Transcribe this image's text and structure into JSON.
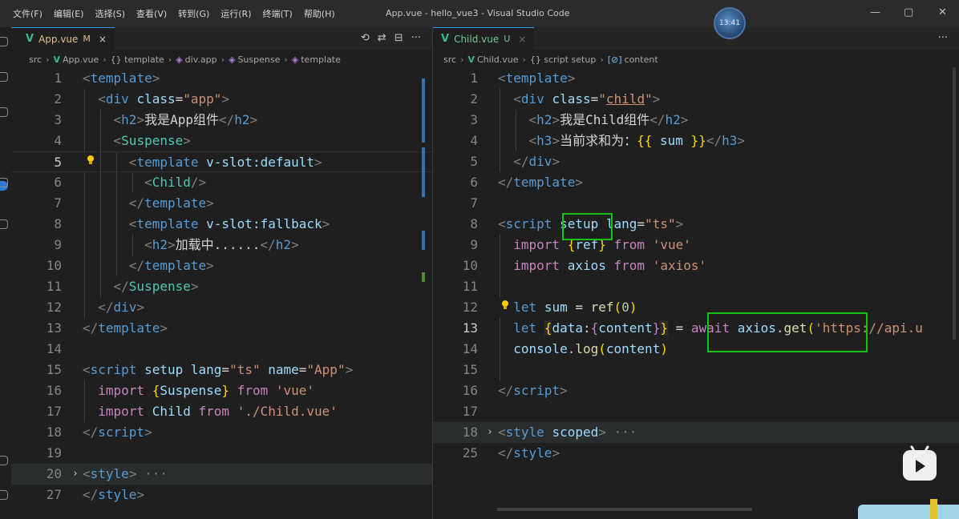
{
  "menu": [
    "文件(F)",
    "编辑(E)",
    "选择(S)",
    "查看(V)",
    "转到(G)",
    "运行(R)",
    "终端(T)",
    "帮助(H)"
  ],
  "window_title": "App.vue - hello_vue3 - Visual Studio Code",
  "clock": "13:41",
  "window_controls": {
    "minimize": "—",
    "restore": "▢",
    "close": "✕"
  },
  "left": {
    "tab": {
      "icon": "vue-icon",
      "label": "App.vue",
      "flag": "M",
      "close": "×"
    },
    "actions": [
      "⟲",
      "⇄",
      "⊟",
      "···"
    ],
    "breadcrumb": [
      "src",
      "App.vue",
      "{} template",
      "div.app",
      "Suspense",
      "template"
    ],
    "line_numbers": [
      "1",
      "2",
      "3",
      "4",
      "5",
      "6",
      "7",
      "8",
      "9",
      "10",
      "11",
      "12",
      "13",
      "14",
      "15",
      "16",
      "17",
      "18",
      "19",
      "20",
      "27"
    ]
  },
  "right": {
    "tab": {
      "icon": "vue-icon",
      "label": "Child.vue",
      "flag": "U",
      "close": "×"
    },
    "actions": [
      "···"
    ],
    "breadcrumb": [
      "src",
      "Child.vue",
      "{} script setup",
      "content"
    ],
    "line_numbers": [
      "1",
      "2",
      "3",
      "4",
      "5",
      "6",
      "7",
      "8",
      "9",
      "10",
      "11",
      "12",
      "13",
      "14",
      "15",
      "16",
      "17",
      "18",
      "25"
    ]
  },
  "colors": {
    "highlight_box": "#17c217",
    "accent": "#3794ff",
    "vue": "#41b883"
  }
}
